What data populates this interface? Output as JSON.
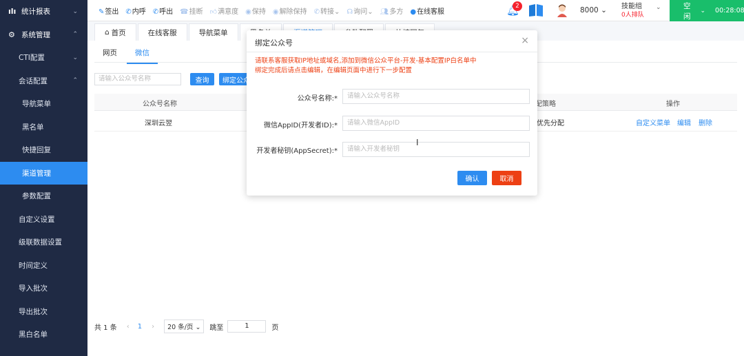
{
  "sidebar": {
    "items": [
      {
        "label": "统计报表",
        "icon": "bar-chart-icon",
        "chevron": "⌄"
      },
      {
        "label": "系统管理",
        "icon": "gear-icon",
        "chevron": "⌃"
      },
      {
        "label": "CTI配置",
        "chevron": "⌄"
      },
      {
        "label": "会话配置",
        "chevron": "⌃"
      },
      {
        "label": "导航菜单"
      },
      {
        "label": "黑名单"
      },
      {
        "label": "快捷回复"
      },
      {
        "label": "渠道管理"
      },
      {
        "label": "参数配置"
      },
      {
        "label": "自定义设置"
      },
      {
        "label": "级联数据设置"
      },
      {
        "label": "时间定义"
      },
      {
        "label": "导入批次"
      },
      {
        "label": "导出批次"
      },
      {
        "label": "黑白名单"
      }
    ]
  },
  "topbar": {
    "tools": [
      "签出",
      "内呼",
      "呼出",
      "挂断",
      "满意度",
      "保持",
      "解除保持",
      "转接",
      "询问",
      "多方",
      "在线客服"
    ],
    "bell_count": "2",
    "extension": "8000",
    "skill_group": "技能组",
    "queue": "0人排队",
    "status": "空闲",
    "timer": "00:28:08",
    "chev": "⌄"
  },
  "tabs": [
    "首页",
    "在线客服",
    "导航菜单",
    "黑名单",
    "渠道管理",
    "参数配置",
    "快捷回复"
  ],
  "subtabs": [
    "网页",
    "微信"
  ],
  "search": {
    "placeholder": "请输入公众号名称",
    "query_btn": "查询",
    "bind_btn": "绑定公众号"
  },
  "table": {
    "headers": [
      "公众号名称",
      "分配策略",
      "操作"
    ],
    "rows": [
      {
        "name": "深圳云翌",
        "strategy": "服务优先分配",
        "ops": [
          "自定义菜单",
          "编辑",
          "删除"
        ]
      }
    ]
  },
  "pager": {
    "total": "共 1 条",
    "prev": "‹",
    "page": "1",
    "next": "›",
    "size": "20 条/页 ⌄",
    "goto": "跳至",
    "goto_val": "1",
    "unit": "页"
  },
  "dialog": {
    "title": "绑定公众号",
    "close": "×",
    "notice1": "请联系客服获取IP地址或域名,添加到微信公众平台-开发-基本配置IP白名单中",
    "notice2": "绑定完成后请点击编辑，在编辑页面中进行下一步配置",
    "fields": [
      {
        "label": "公众号名称:*",
        "placeholder": "请输入公众号名称"
      },
      {
        "label": "微信AppID(开发者ID):*",
        "placeholder": "请输入微信AppID"
      },
      {
        "label": "开发者秘钥(AppSecret):*",
        "placeholder": "请输入开发者秘钥"
      }
    ],
    "ok": "确认",
    "cancel": "取消"
  }
}
